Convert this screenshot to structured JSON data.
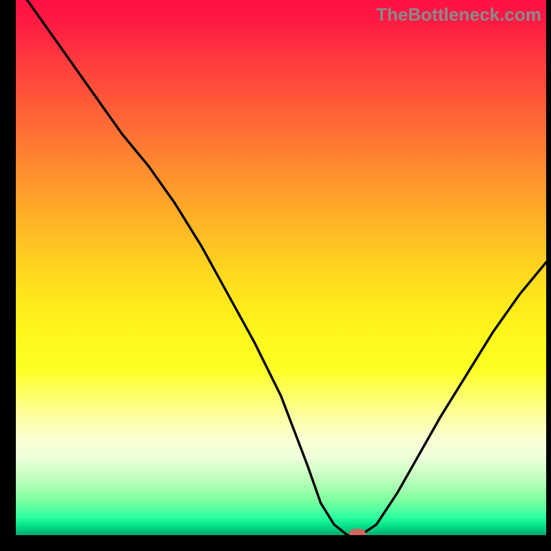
{
  "watermark": "TheBottleneck.com",
  "marker": {
    "x_frac": 0.644,
    "y_pct": 0
  },
  "chart_data": {
    "type": "line",
    "title": "",
    "xlabel": "",
    "ylabel": "",
    "xlim": [
      0,
      1
    ],
    "ylim": [
      0,
      100
    ],
    "series": [
      {
        "name": "bottleneck-curve",
        "x": [
          0.0,
          0.05,
          0.1,
          0.15,
          0.2,
          0.25,
          0.3,
          0.35,
          0.4,
          0.45,
          0.5,
          0.55,
          0.575,
          0.6,
          0.625,
          0.65,
          0.68,
          0.72,
          0.76,
          0.8,
          0.85,
          0.9,
          0.95,
          1.0
        ],
        "y": [
          103,
          96,
          89,
          82,
          75,
          69,
          62,
          54,
          45,
          36,
          26,
          13,
          6,
          2,
          0,
          0,
          2,
          8,
          15,
          22,
          30,
          38,
          45,
          51
        ]
      }
    ],
    "gradient_stops_pct_from_top_to_color": [
      [
        0,
        "#ff1044"
      ],
      [
        25,
        "#ff7a30"
      ],
      [
        50,
        "#ffd420"
      ],
      [
        70,
        "#feff3a"
      ],
      [
        82,
        "#fbffd2"
      ],
      [
        92,
        "#7dff9e"
      ],
      [
        100,
        "#00a86e"
      ]
    ]
  }
}
